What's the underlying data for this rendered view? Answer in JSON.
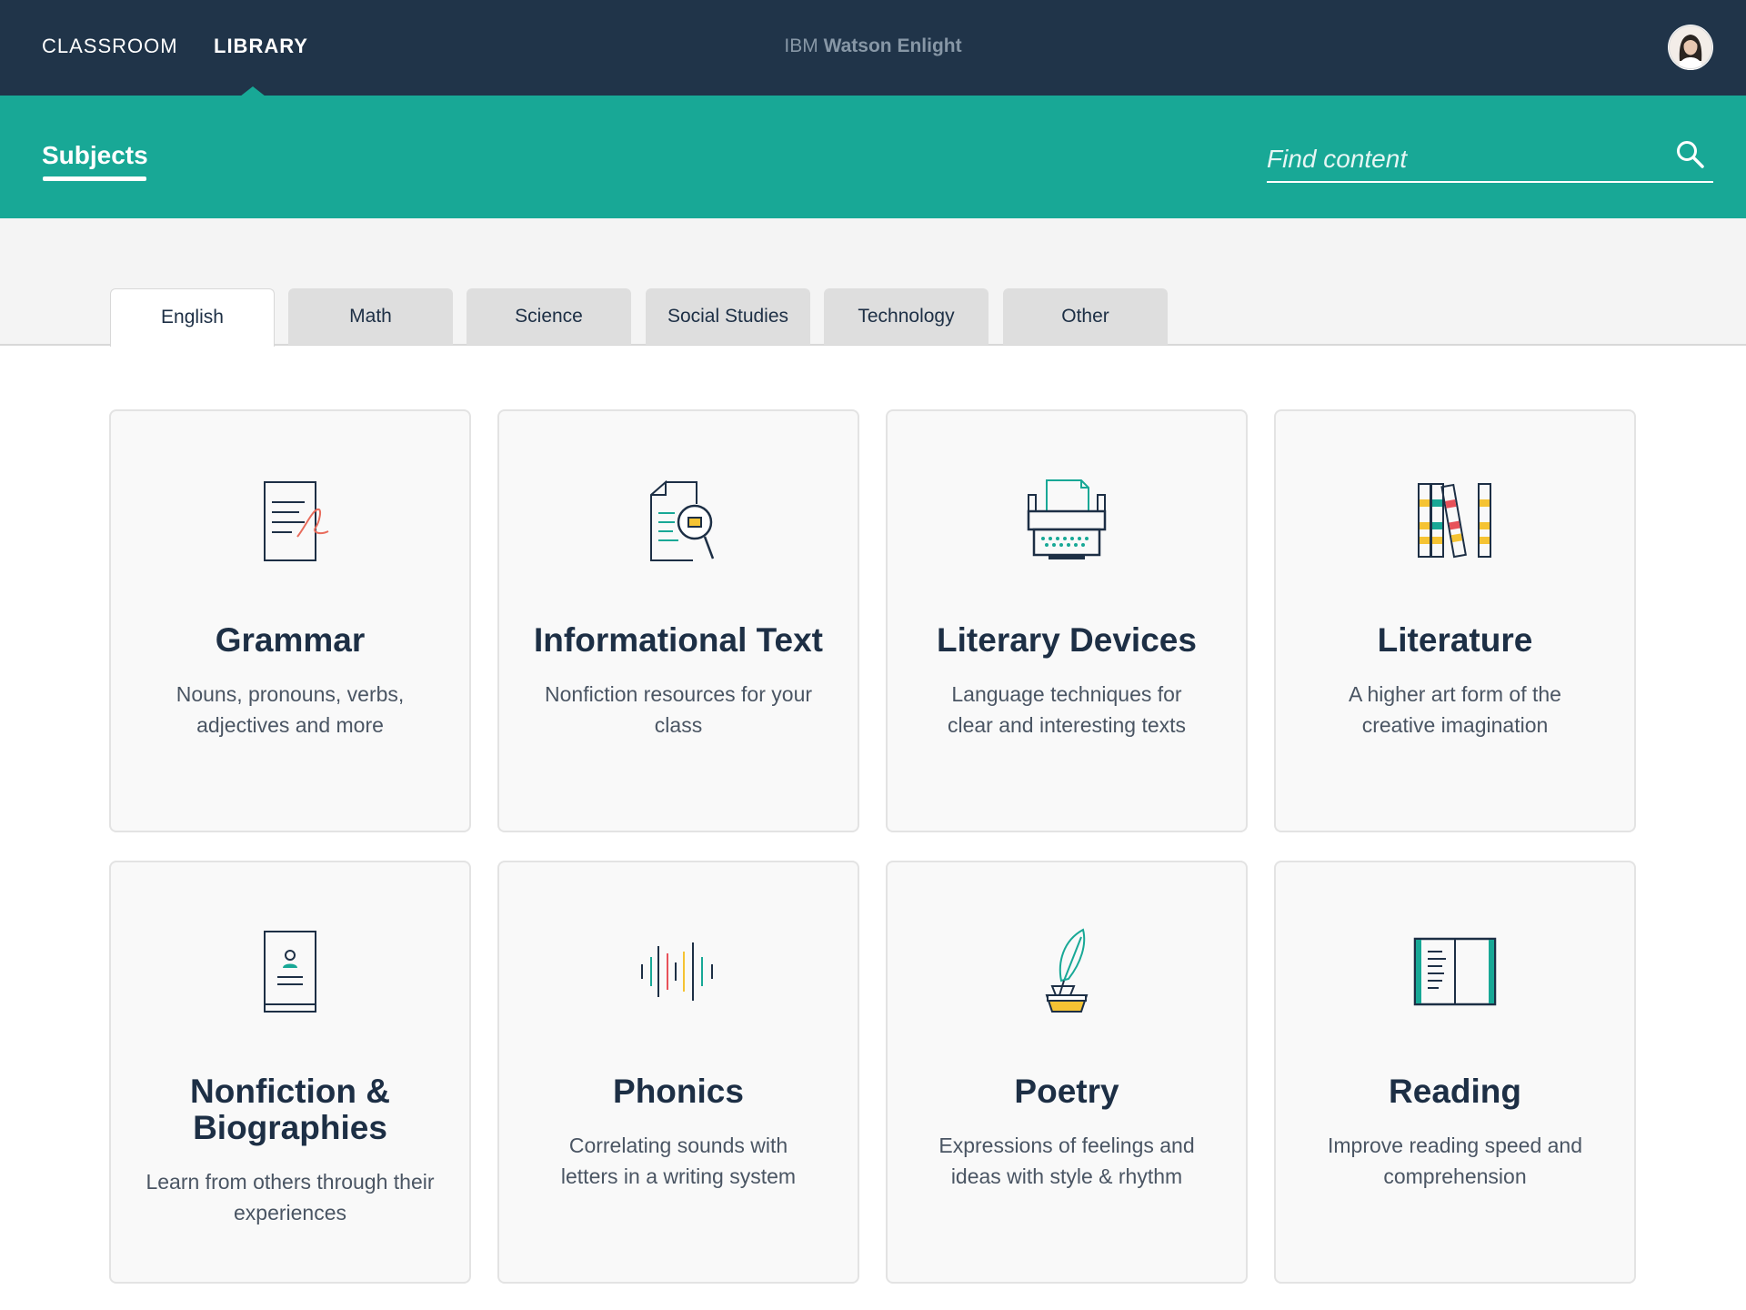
{
  "topbar": {
    "nav": [
      {
        "label": "CLASSROOM"
      },
      {
        "label": "LIBRARY"
      }
    ],
    "brand_prefix": "IBM",
    "brand_name": "Watson Enlight",
    "avatar_icon": "user-avatar"
  },
  "subheader": {
    "title": "Subjects",
    "search_placeholder": "Find content",
    "search_icon": "search-icon"
  },
  "tabs": [
    {
      "label": "English",
      "active": true
    },
    {
      "label": "Math",
      "active": false
    },
    {
      "label": "Science",
      "active": false
    },
    {
      "label": "Social Studies",
      "active": false
    },
    {
      "label": "Technology",
      "active": false
    },
    {
      "label": "Other",
      "active": false
    }
  ],
  "cards": [
    {
      "title": "Grammar",
      "desc": "Nouns, pronouns, verbs, adjectives and more",
      "icon": "document-signature-icon"
    },
    {
      "title": "Informational Text",
      "desc": "Nonfiction resources for your class",
      "icon": "document-magnifier-icon"
    },
    {
      "title": "Literary Devices",
      "desc": "Language techniques for clear and interesting texts",
      "icon": "typewriter-icon"
    },
    {
      "title": "Literature",
      "desc": "A higher art form of the creative imagination",
      "icon": "books-icon"
    },
    {
      "title": "Nonfiction & Biographies",
      "desc": "Learn from others through their experiences",
      "icon": "biography-book-icon"
    },
    {
      "title": "Phonics",
      "desc": "Correlating sounds with letters in a writing system",
      "icon": "sound-wave-icon"
    },
    {
      "title": "Poetry",
      "desc": "Expressions of feelings and ideas with style & rhythm",
      "icon": "quill-ink-icon"
    },
    {
      "title": "Reading",
      "desc": "Improve reading speed and comprehension",
      "icon": "open-book-icon"
    }
  ],
  "colors": {
    "navy": "#203449",
    "teal": "#18a896",
    "yellow": "#f5c333",
    "red": "#e8525a",
    "coral": "#e86c5c"
  }
}
